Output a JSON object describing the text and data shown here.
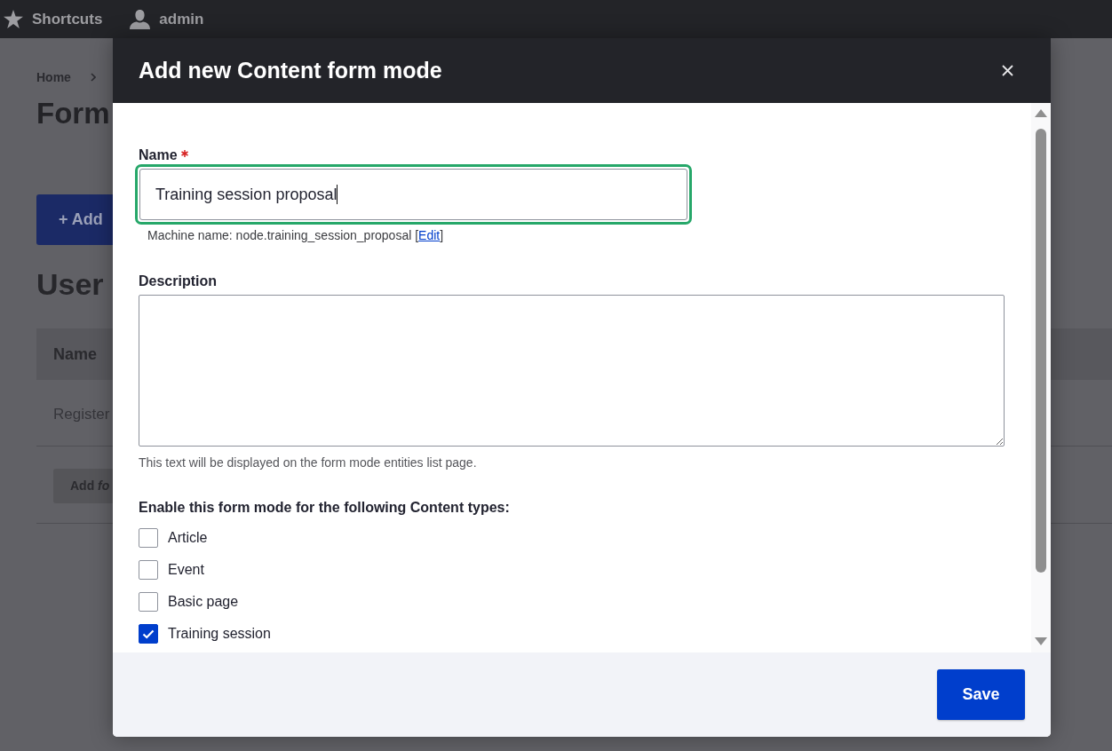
{
  "toolbar": {
    "items": [
      {
        "label": "Shortcuts"
      },
      {
        "label": "admin"
      }
    ]
  },
  "page": {
    "breadcrumb": [
      {
        "label": "Home"
      }
    ],
    "title": "Form",
    "add_button": "+ Add",
    "section_title": "User",
    "table": {
      "columns": [
        "Name"
      ],
      "rows": [
        [
          "Register"
        ]
      ]
    },
    "table_button": "Add *fo*"
  },
  "dialog": {
    "title": "Add new Content form mode",
    "name_field": {
      "label": "Name",
      "required": true,
      "value": "Training session proposal",
      "focused": true,
      "machine_name": {
        "text": "Machine name: node.training_session_proposal [",
        "link": "Edit",
        "after": "]"
      }
    },
    "description_field": {
      "label": "Description",
      "help": "This text will be displayed on the form mode entities list page."
    },
    "content_types": {
      "label": "Enable this form mode for the following Content types:",
      "options": [
        {
          "label": "Article",
          "checked": false
        },
        {
          "label": "Event",
          "checked": false
        },
        {
          "label": "Basic page",
          "checked": false
        },
        {
          "label": "Training session",
          "checked": true
        }
      ]
    },
    "buttons": [
      "Save"
    ]
  }
}
